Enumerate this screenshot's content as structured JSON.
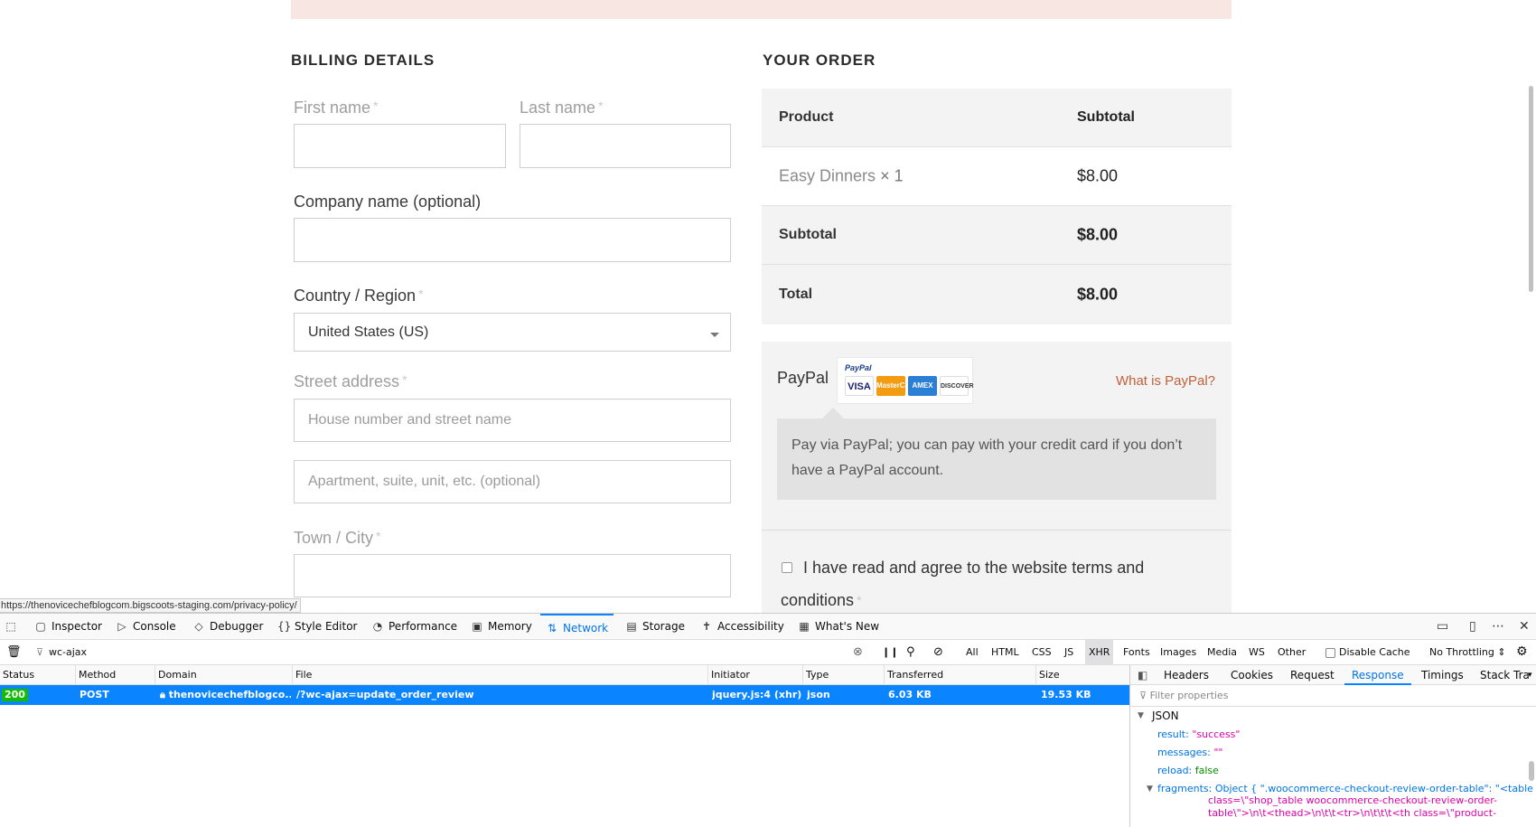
{
  "billing": {
    "title": "BILLING DETAILS",
    "first_name_label": "First name",
    "last_name_label": "Last name",
    "company_label": "Company name (optional)",
    "country_label": "Country / Region",
    "country_value": "United States (US)",
    "street_label": "Street address",
    "street_placeholder": "House number and street name",
    "apartment_placeholder": "Apartment, suite, unit, etc. (optional)",
    "city_label": "Town / City",
    "required_mark": "*"
  },
  "order": {
    "title": "YOUR ORDER",
    "col_product": "Product",
    "col_subtotal": "Subtotal",
    "item_name": "Easy Dinners",
    "item_qty": "× 1",
    "item_price": "$8.00",
    "subtotal_label": "Subtotal",
    "subtotal_value": "$8.00",
    "total_label": "Total",
    "total_value": "$8.00"
  },
  "payment": {
    "method_label": "PayPal",
    "brand": "PayPal",
    "cards": [
      "VISA",
      "MasterCard",
      "AMEX",
      "DISCOVER"
    ],
    "what_is_link": "What is PayPal?",
    "description": "Pay via PayPal; you can pay with your credit card if you don’t have a PayPal account.",
    "terms_text": "I have read and agree to the website terms and conditions",
    "terms_required": "*"
  },
  "status_url": "https://thenovicechefblogcom.bigscoots-staging.com/privacy-policy/",
  "devtools": {
    "tabs": [
      {
        "label": "Inspector",
        "icon": "inspector-icon",
        "glyph": "▢"
      },
      {
        "label": "Console",
        "icon": "console-icon",
        "glyph": "▷"
      },
      {
        "label": "Debugger",
        "icon": "debugger-icon",
        "glyph": "◇"
      },
      {
        "label": "Style Editor",
        "icon": "braces-icon",
        "glyph": "{}"
      },
      {
        "label": "Performance",
        "icon": "performance-icon",
        "glyph": "◔"
      },
      {
        "label": "Memory",
        "icon": "memory-icon",
        "glyph": "▣"
      },
      {
        "label": "Network",
        "icon": "network-icon",
        "glyph": "⇅"
      },
      {
        "label": "Storage",
        "icon": "storage-icon",
        "glyph": "▤"
      },
      {
        "label": "Accessibility",
        "icon": "accessibility-icon",
        "glyph": "✝"
      },
      {
        "label": "What's New",
        "icon": "gift-icon",
        "glyph": "▦"
      }
    ],
    "filter_text": "wc-ajax",
    "type_filters": [
      "All",
      "HTML",
      "CSS",
      "JS",
      "XHR",
      "Fonts",
      "Images",
      "Media",
      "WS",
      "Other"
    ],
    "selected_filter": "XHR",
    "disable_cache": "Disable Cache",
    "throttling": "No Throttling",
    "columns": [
      "Status",
      "Method",
      "Domain",
      "File",
      "Initiator",
      "Type",
      "Transferred",
      "Size"
    ],
    "request": {
      "status": "200",
      "method": "POST",
      "domain": "thenovicechefblogco...",
      "file": "/?wc-ajax=update_order_review",
      "initiator": "jquery.js:4 (xhr)",
      "type": "json",
      "transferred": "6.03 KB",
      "size": "19.53 KB"
    },
    "side_tabs": [
      "Headers",
      "Cookies",
      "Request",
      "Response",
      "Timings",
      "Stack Tra"
    ],
    "active_side_tab": "Response",
    "filter_properties_placeholder": "Filter properties",
    "json_root": "JSON",
    "json": {
      "result_key": "result:",
      "result_val": "\"success\"",
      "messages_key": "messages:",
      "messages_val": "\"\"",
      "reload_key": "reload:",
      "reload_val": "false",
      "fragments_key": "fragments:",
      "fragments_val": "Object { \".woocommerce-checkout-review-order-table\": \"<table",
      "fragments_cont1": "class=\\\"shop_table woocommerce-checkout-review-order-",
      "fragments_cont2": "table\\\">\\n\\t<thead>\\n\\t\\t<tr>\\n\\t\\t\\t<th class=\\\"product-"
    }
  }
}
